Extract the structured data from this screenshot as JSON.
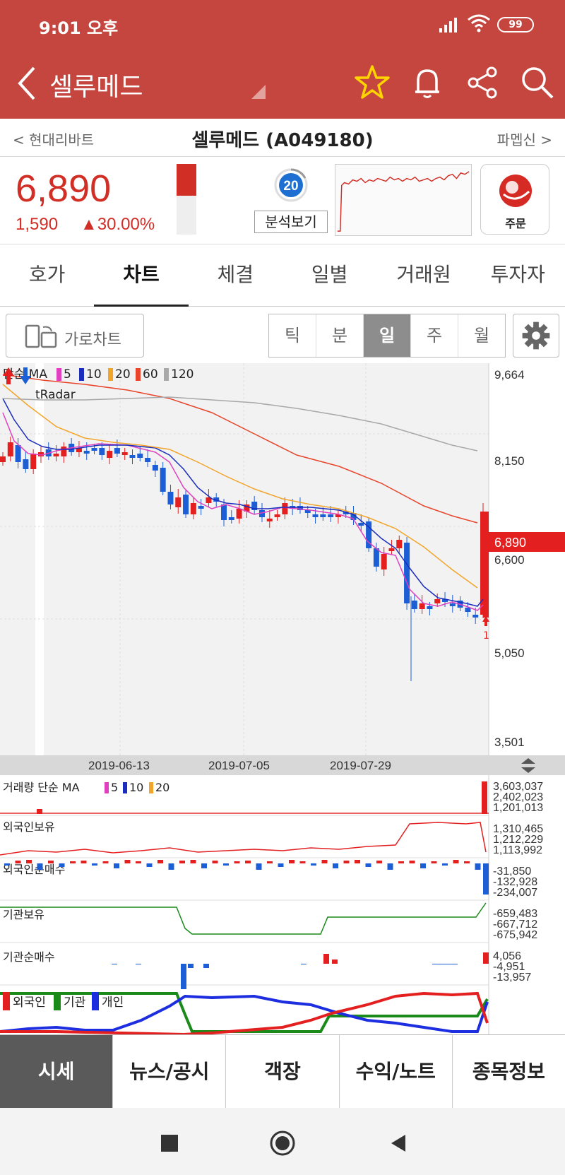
{
  "status": {
    "time": "9:01 오후",
    "battery": "99"
  },
  "header": {
    "title": "셀루메드"
  },
  "stock_nav": {
    "prev": "< 현대리바트",
    "name": "셀루메드 (A049180)",
    "next": "파멥신 >"
  },
  "quote": {
    "price": "6,890",
    "change": "1,590",
    "change_pct": "▲30.00%",
    "analysis_score": "20",
    "analysis_button": "분석보기",
    "order_label": "주문",
    "day_range_fill_pct": 45
  },
  "tabs": [
    "호가",
    "차트",
    "체결",
    "일별",
    "거래원",
    "투자자"
  ],
  "active_tab": "차트",
  "toolbar": {
    "landscape_label": "가로차트",
    "periods": [
      "틱",
      "분",
      "일",
      "주",
      "월"
    ],
    "selected_period": "일"
  },
  "chart_data": {
    "type": "candlestick",
    "legend_label": "단순 MA",
    "ma_periods": [
      "5",
      "10",
      "20",
      "60",
      "120"
    ],
    "ma_colors": [
      "#e040c0",
      "#1a2dbd",
      "#f2a52a",
      "#e8452a",
      "#a8a8a8"
    ],
    "radar_label": "tRadar",
    "y_ticks": [
      "9,664",
      "8,150",
      "6,600",
      "5,050",
      "3,501"
    ],
    "current_price": "6,890",
    "x_ticks": [
      "2019-06-13",
      "2019-07-05",
      "2019-07-29"
    ],
    "marker_label": "1",
    "ylim": [
      3501,
      9664
    ]
  },
  "subcharts": {
    "volume": {
      "label": "거래량 단순 MA",
      "ma": [
        "5",
        "10",
        "20"
      ],
      "ticks": [
        "3,603,037",
        "2,402,023",
        "1,201,013"
      ]
    },
    "foreign_hold": {
      "label": "외국인보유",
      "ticks": [
        "1,310,465",
        "1,212,229",
        "1,113,992"
      ]
    },
    "foreign_net": {
      "label": "외국인순매수",
      "ticks": [
        "-31,850",
        "-132,928",
        "-234,007"
      ]
    },
    "inst_hold": {
      "label": "기관보유",
      "ticks": [
        "-659,483",
        "-667,712",
        "-675,942"
      ]
    },
    "inst_net": {
      "label": "기관순매수",
      "ticks": [
        "4,056",
        "-4,951",
        "-13,957"
      ]
    },
    "investor_legend": [
      "외국인",
      "기관",
      "개인"
    ]
  },
  "bottom_tabs": [
    "시세",
    "뉴스/공시",
    "객장",
    "수익/노트",
    "종목정보"
  ],
  "active_bottom_tab": "시세",
  "colors": {
    "brand": "#c4463e",
    "up": "#e31f1f",
    "down": "#1c5ed6"
  }
}
